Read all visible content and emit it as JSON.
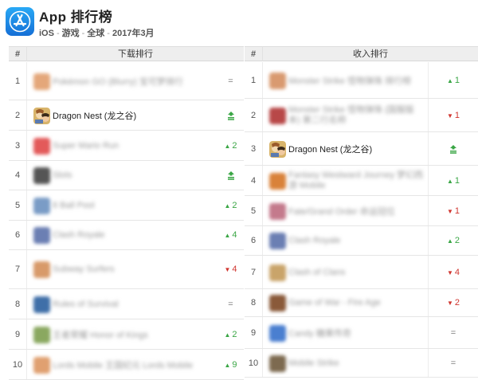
{
  "header": {
    "title": "App 排行榜",
    "platform": "iOS",
    "category": "游戏",
    "region": "全球",
    "date": "2017年3月",
    "separator": "-",
    "logo_icon": "app-store-icon",
    "accent_color": "#1a8cf0"
  },
  "left_table": {
    "hash_header": "#",
    "title_header": "下载排行",
    "rows": [
      {
        "rank": "1",
        "name": "Pokémon GO (Blurry) 宝可梦排行",
        "change": "=",
        "type": "eq",
        "icon_color": "#e4a77a"
      },
      {
        "rank": "2",
        "name": "Dragon Nest (龙之谷)",
        "change": "",
        "type": "new",
        "icon_color": "#c99b4e",
        "clear": true
      },
      {
        "rank": "3",
        "name": "Super Mario Run",
        "change": "2",
        "type": "up",
        "icon_color": "#e35a5a"
      },
      {
        "rank": "4",
        "name": "Slots",
        "change": "",
        "type": "new",
        "icon_color": "#555555"
      },
      {
        "rank": "5",
        "name": "8 Ball Pool",
        "change": "2",
        "type": "up",
        "icon_color": "#7a9cc6"
      },
      {
        "rank": "6",
        "name": "Clash Royale",
        "change": "4",
        "type": "up",
        "icon_color": "#6b7fb3"
      },
      {
        "rank": "7",
        "name": "Subway Surfers",
        "change": "4",
        "type": "down",
        "icon_color": "#d89a6a"
      },
      {
        "rank": "8",
        "name": "Rules of Survival",
        "change": "=",
        "type": "eq",
        "icon_color": "#3f6fa8"
      },
      {
        "rank": "9",
        "name": "王者荣耀 Honor of Kings",
        "change": "2",
        "type": "up",
        "icon_color": "#8aa860"
      },
      {
        "rank": "10",
        "name": "Lords Mobile 王国纪元 Lords Mobile",
        "change": "9",
        "type": "up",
        "icon_color": "#e0a070"
      }
    ]
  },
  "right_table": {
    "hash_header": "#",
    "title_header": "收入排行",
    "rows": [
      {
        "rank": "1",
        "name": "Monster Strike 怪物弹珠 排行榜",
        "change": "1",
        "type": "up",
        "icon_color": "#d99a70"
      },
      {
        "rank": "2",
        "name": "Monster Strike 怪物弹珠 (国服版本) 第二行名称",
        "change": "1",
        "type": "down",
        "icon_color": "#b84848",
        "wrap": true
      },
      {
        "rank": "3",
        "name": "Dragon Nest (龙之谷)",
        "change": "",
        "type": "new",
        "icon_color": "#c99b4e",
        "clear": true
      },
      {
        "rank": "4",
        "name": "Fantasy Westward Journey 梦幻西游 Mobile",
        "change": "1",
        "type": "up",
        "icon_color": "#d9823a",
        "wrap": true
      },
      {
        "rank": "5",
        "name": "Fate/Grand Order 命运冠位",
        "change": "1",
        "type": "down",
        "icon_color": "#c47a8c"
      },
      {
        "rank": "6",
        "name": "Clash Royale",
        "change": "2",
        "type": "up",
        "icon_color": "#6b7fb3"
      },
      {
        "rank": "7",
        "name": "Clash of Clans",
        "change": "4",
        "type": "down",
        "icon_color": "#c9a46a"
      },
      {
        "rank": "8",
        "name": "Game of War - Fire Age",
        "change": "2",
        "type": "down",
        "icon_color": "#8a5a3a"
      },
      {
        "rank": "9",
        "name": "Candy 糖果传奇",
        "change": "=",
        "type": "eq",
        "icon_color": "#4a7fd0"
      },
      {
        "rank": "10",
        "name": "Mobile Strike",
        "change": "=",
        "type": "eq",
        "icon_color": "#7d6a50"
      }
    ]
  }
}
